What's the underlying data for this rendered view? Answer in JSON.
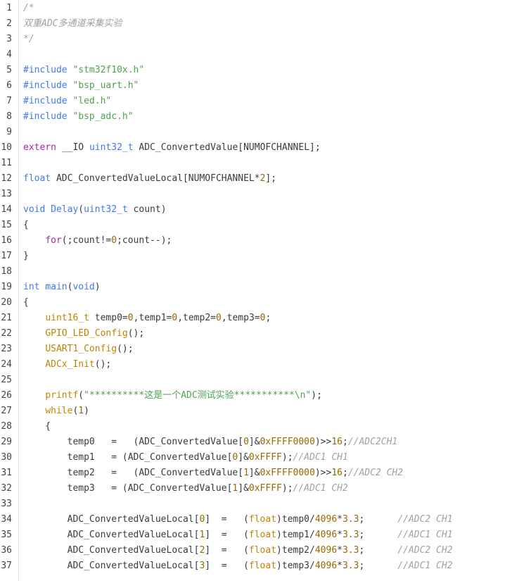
{
  "colors": {
    "comment": "#a0a1a7",
    "preprocessor": "#4078f2",
    "string": "#50a14f",
    "keyword": "#a626a4",
    "type": "#4078f2",
    "function": "#c18401",
    "number": "#986801",
    "plain": "#383a42",
    "line_number": "#444444"
  },
  "editor": {
    "lines": [
      {
        "n": "1",
        "tokens": [
          {
            "t": "comment",
            "v": "/*"
          }
        ]
      },
      {
        "n": "2",
        "tokens": [
          {
            "t": "comment",
            "v": "双重ADC多通道采集实验"
          }
        ]
      },
      {
        "n": "3",
        "tokens": [
          {
            "t": "comment",
            "v": "*/"
          }
        ]
      },
      {
        "n": "4",
        "tokens": []
      },
      {
        "n": "5",
        "tokens": [
          {
            "t": "preproc",
            "v": "#include "
          },
          {
            "t": "string",
            "v": "\"stm32f10x.h\""
          }
        ]
      },
      {
        "n": "6",
        "tokens": [
          {
            "t": "preproc",
            "v": "#include "
          },
          {
            "t": "string",
            "v": "\"bsp_uart.h\""
          }
        ]
      },
      {
        "n": "7",
        "tokens": [
          {
            "t": "preproc",
            "v": "#include "
          },
          {
            "t": "string",
            "v": "\"led.h\""
          }
        ]
      },
      {
        "n": "8",
        "tokens": [
          {
            "t": "preproc",
            "v": "#include "
          },
          {
            "t": "string",
            "v": "\"bsp_adc.h\""
          }
        ]
      },
      {
        "n": "9",
        "tokens": []
      },
      {
        "n": "10",
        "tokens": [
          {
            "t": "keyword",
            "v": "extern"
          },
          {
            "t": "plain",
            "v": " __IO "
          },
          {
            "t": "type",
            "v": "uint32_t"
          },
          {
            "t": "plain",
            "v": " ADC_ConvertedValue[NUMOFCHANNEL];"
          }
        ]
      },
      {
        "n": "11",
        "tokens": []
      },
      {
        "n": "12",
        "tokens": [
          {
            "t": "type",
            "v": "float"
          },
          {
            "t": "plain",
            "v": " ADC_ConvertedValueLocal[NUMOFCHANNEL*"
          },
          {
            "t": "number",
            "v": "2"
          },
          {
            "t": "plain",
            "v": "];"
          }
        ]
      },
      {
        "n": "13",
        "tokens": []
      },
      {
        "n": "14",
        "tokens": [
          {
            "t": "type",
            "v": "void"
          },
          {
            "t": "plain",
            "v": " "
          },
          {
            "t": "preproc",
            "v": "Delay"
          },
          {
            "t": "plain",
            "v": "("
          },
          {
            "t": "type",
            "v": "uint32_t"
          },
          {
            "t": "plain",
            "v": " count)"
          }
        ]
      },
      {
        "n": "15",
        "tokens": [
          {
            "t": "plain",
            "v": "{"
          }
        ]
      },
      {
        "n": "16",
        "tokens": [
          {
            "t": "plain",
            "v": "    "
          },
          {
            "t": "keyword",
            "v": "for"
          },
          {
            "t": "plain",
            "v": "(;count!="
          },
          {
            "t": "number",
            "v": "0"
          },
          {
            "t": "plain",
            "v": ";count--);"
          }
        ]
      },
      {
        "n": "17",
        "tokens": [
          {
            "t": "plain",
            "v": "}"
          }
        ]
      },
      {
        "n": "18",
        "tokens": []
      },
      {
        "n": "19",
        "tokens": [
          {
            "t": "type",
            "v": "int"
          },
          {
            "t": "plain",
            "v": " "
          },
          {
            "t": "preproc",
            "v": "main"
          },
          {
            "t": "plain",
            "v": "("
          },
          {
            "t": "type",
            "v": "void"
          },
          {
            "t": "plain",
            "v": ")"
          }
        ]
      },
      {
        "n": "20",
        "tokens": [
          {
            "t": "plain",
            "v": "{"
          }
        ]
      },
      {
        "n": "21",
        "tokens": [
          {
            "t": "plain",
            "v": "    "
          },
          {
            "t": "func",
            "v": "uint16_t"
          },
          {
            "t": "plain",
            "v": " temp0="
          },
          {
            "t": "number",
            "v": "0"
          },
          {
            "t": "plain",
            "v": ",temp1="
          },
          {
            "t": "number",
            "v": "0"
          },
          {
            "t": "plain",
            "v": ",temp2="
          },
          {
            "t": "number",
            "v": "0"
          },
          {
            "t": "plain",
            "v": ",temp3="
          },
          {
            "t": "number",
            "v": "0"
          },
          {
            "t": "plain",
            "v": ";"
          }
        ]
      },
      {
        "n": "22",
        "tokens": [
          {
            "t": "plain",
            "v": "    "
          },
          {
            "t": "func",
            "v": "GPIO_LED_Config"
          },
          {
            "t": "plain",
            "v": "();"
          }
        ]
      },
      {
        "n": "23",
        "tokens": [
          {
            "t": "plain",
            "v": "    "
          },
          {
            "t": "func",
            "v": "USART1_Config"
          },
          {
            "t": "plain",
            "v": "();"
          }
        ]
      },
      {
        "n": "24",
        "tokens": [
          {
            "t": "plain",
            "v": "    "
          },
          {
            "t": "func",
            "v": "ADCx_Init"
          },
          {
            "t": "plain",
            "v": "();"
          }
        ]
      },
      {
        "n": "25",
        "tokens": []
      },
      {
        "n": "26",
        "tokens": [
          {
            "t": "plain",
            "v": "    "
          },
          {
            "t": "func",
            "v": "printf"
          },
          {
            "t": "plain",
            "v": "("
          },
          {
            "t": "string",
            "v": "\"**********这是一个ADC测试实验***********\\n\""
          },
          {
            "t": "plain",
            "v": ");"
          }
        ]
      },
      {
        "n": "27",
        "tokens": [
          {
            "t": "plain",
            "v": "    "
          },
          {
            "t": "func",
            "v": "while"
          },
          {
            "t": "plain",
            "v": "("
          },
          {
            "t": "number",
            "v": "1"
          },
          {
            "t": "plain",
            "v": ")"
          }
        ]
      },
      {
        "n": "28",
        "tokens": [
          {
            "t": "plain",
            "v": "    {"
          }
        ]
      },
      {
        "n": "29",
        "tokens": [
          {
            "t": "plain",
            "v": "        temp0   =   (ADC_ConvertedValue["
          },
          {
            "t": "number",
            "v": "0"
          },
          {
            "t": "plain",
            "v": "]&"
          },
          {
            "t": "number",
            "v": "0xFFFF0000"
          },
          {
            "t": "plain",
            "v": ")>>"
          },
          {
            "t": "number",
            "v": "16"
          },
          {
            "t": "plain",
            "v": ";"
          },
          {
            "t": "comment",
            "v": "//ADC2CH1"
          }
        ]
      },
      {
        "n": "30",
        "tokens": [
          {
            "t": "plain",
            "v": "        temp1   = (ADC_ConvertedValue["
          },
          {
            "t": "number",
            "v": "0"
          },
          {
            "t": "plain",
            "v": "]&"
          },
          {
            "t": "number",
            "v": "0xFFFF"
          },
          {
            "t": "plain",
            "v": ");"
          },
          {
            "t": "comment",
            "v": "//ADC1 CH1"
          }
        ]
      },
      {
        "n": "31",
        "tokens": [
          {
            "t": "plain",
            "v": "        temp2   =   (ADC_ConvertedValue["
          },
          {
            "t": "number",
            "v": "1"
          },
          {
            "t": "plain",
            "v": "]&"
          },
          {
            "t": "number",
            "v": "0xFFFF0000"
          },
          {
            "t": "plain",
            "v": ")>>"
          },
          {
            "t": "number",
            "v": "16"
          },
          {
            "t": "plain",
            "v": ";"
          },
          {
            "t": "comment",
            "v": "//ADC2 CH2"
          }
        ]
      },
      {
        "n": "32",
        "tokens": [
          {
            "t": "plain",
            "v": "        temp3   = (ADC_ConvertedValue["
          },
          {
            "t": "number",
            "v": "1"
          },
          {
            "t": "plain",
            "v": "]&"
          },
          {
            "t": "number",
            "v": "0xFFFF"
          },
          {
            "t": "plain",
            "v": ");"
          },
          {
            "t": "comment",
            "v": "//ADC1 CH2"
          }
        ]
      },
      {
        "n": "33",
        "tokens": []
      },
      {
        "n": "34",
        "tokens": [
          {
            "t": "plain",
            "v": "        ADC_ConvertedValueLocal["
          },
          {
            "t": "number",
            "v": "0"
          },
          {
            "t": "plain",
            "v": "]  =   ("
          },
          {
            "t": "func",
            "v": "float"
          },
          {
            "t": "plain",
            "v": ")temp0/"
          },
          {
            "t": "number",
            "v": "4096"
          },
          {
            "t": "plain",
            "v": "*"
          },
          {
            "t": "number",
            "v": "3.3"
          },
          {
            "t": "plain",
            "v": ";      "
          },
          {
            "t": "comment",
            "v": "//ADC2 CH1"
          }
        ]
      },
      {
        "n": "35",
        "tokens": [
          {
            "t": "plain",
            "v": "        ADC_ConvertedValueLocal["
          },
          {
            "t": "number",
            "v": "1"
          },
          {
            "t": "plain",
            "v": "]  =   ("
          },
          {
            "t": "func",
            "v": "float"
          },
          {
            "t": "plain",
            "v": ")temp1/"
          },
          {
            "t": "number",
            "v": "4096"
          },
          {
            "t": "plain",
            "v": "*"
          },
          {
            "t": "number",
            "v": "3.3"
          },
          {
            "t": "plain",
            "v": ";      "
          },
          {
            "t": "comment",
            "v": "//ADC1 CH1"
          }
        ]
      },
      {
        "n": "36",
        "tokens": [
          {
            "t": "plain",
            "v": "        ADC_ConvertedValueLocal["
          },
          {
            "t": "number",
            "v": "2"
          },
          {
            "t": "plain",
            "v": "]  =   ("
          },
          {
            "t": "func",
            "v": "float"
          },
          {
            "t": "plain",
            "v": ")temp2/"
          },
          {
            "t": "number",
            "v": "4096"
          },
          {
            "t": "plain",
            "v": "*"
          },
          {
            "t": "number",
            "v": "3.3"
          },
          {
            "t": "plain",
            "v": ";      "
          },
          {
            "t": "comment",
            "v": "//ADC2 CH2"
          }
        ]
      },
      {
        "n": "37",
        "tokens": [
          {
            "t": "plain",
            "v": "        ADC_ConvertedValueLocal["
          },
          {
            "t": "number",
            "v": "3"
          },
          {
            "t": "plain",
            "v": "]  =   ("
          },
          {
            "t": "func",
            "v": "float"
          },
          {
            "t": "plain",
            "v": ")temp3/"
          },
          {
            "t": "number",
            "v": "4096"
          },
          {
            "t": "plain",
            "v": "*"
          },
          {
            "t": "number",
            "v": "3.3"
          },
          {
            "t": "plain",
            "v": ";      "
          },
          {
            "t": "comment",
            "v": "//ADC1 CH2"
          }
        ]
      }
    ]
  }
}
